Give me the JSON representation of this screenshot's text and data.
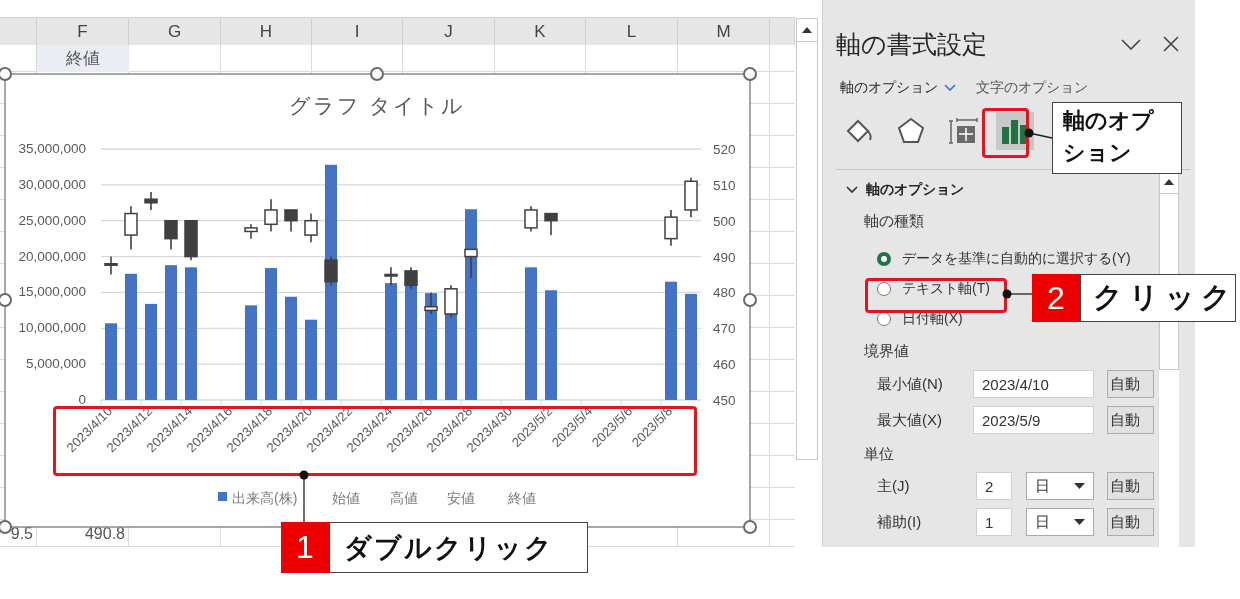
{
  "sheet": {
    "column_headers": [
      "F",
      "G",
      "H",
      "I",
      "J",
      "K",
      "L",
      "M"
    ],
    "rows": [
      {
        "header": true,
        "cells": [
          null,
          "終値"
        ]
      },
      {
        "header": false,
        "cells": [
          "9.5",
          "490.8"
        ]
      }
    ]
  },
  "chart": {
    "selected": true,
    "volume": {
      "chart_data": {
        "type": "bar",
        "title": "グラフ タイトル",
        "categories": [
          "2023/4/10",
          null,
          "2023/4/12",
          null,
          "2023/4/14",
          null,
          "2023/4/16",
          null,
          "2023/4/18",
          null,
          "2023/4/20",
          null,
          "2023/4/22",
          null,
          "2023/4/24",
          null,
          "2023/4/26",
          null,
          "2023/4/28",
          null,
          "2023/4/30",
          null,
          "2023/5/2",
          null,
          "2023/5/4",
          null,
          "2023/5/6",
          null,
          "2023/5/8",
          null
        ],
        "ylim": [
          0,
          35000000
        ],
        "grid": true,
        "yticks": [
          {
            "value": 0,
            "label": "0"
          },
          {
            "value": 5000000,
            "label": "5,000,000"
          },
          {
            "value": 10000000,
            "label": "10,000,000"
          },
          {
            "value": 15000000,
            "label": "15,000,000"
          },
          {
            "value": 20000000,
            "label": "20,000,000"
          },
          {
            "value": 25000000,
            "label": "25,000,000"
          },
          {
            "value": 30000000,
            "label": "30,000,000"
          },
          {
            "value": 35000000,
            "label": "35,000,000"
          }
        ],
        "series": [
          {
            "name": "出来高(株)",
            "color": "#4472c4",
            "values": [
              10700000,
              17600000,
              13400000,
              18800000,
              18500000,
              null,
              null,
              13200000,
              18400000,
              14400000,
              11200000,
              32800000,
              null,
              null,
              16300000,
              16000000,
              14900000,
              15600000,
              26600000,
              null,
              null,
              18500000,
              15300000,
              null,
              null,
              null,
              null,
              null,
              16500000,
              14800000
            ]
          }
        ]
      }
    },
    "prices": {
      "legend": [
        "始値",
        "高値",
        "安値",
        "終値"
      ],
      "chart_data": {
        "type": "candlestick",
        "categories": [
          null,
          null,
          null,
          null,
          null,
          null,
          null,
          null,
          null,
          null,
          null,
          null,
          null,
          null,
          null,
          null,
          null,
          null,
          null,
          null,
          null,
          null,
          null,
          null,
          null,
          null,
          null,
          null,
          null,
          null
        ],
        "ylim": [
          450,
          520
        ],
        "yticks": [
          {
            "value": 450,
            "label": "450"
          },
          {
            "value": 460,
            "label": "460"
          },
          {
            "value": 470,
            "label": "470"
          },
          {
            "value": 480,
            "label": "480"
          },
          {
            "value": 490,
            "label": "490"
          },
          {
            "value": 500,
            "label": "500"
          },
          {
            "value": 510,
            "label": "510"
          },
          {
            "value": 520,
            "label": "520"
          }
        ],
        "ohlc": [
          [
            488,
            490,
            485,
            488
          ],
          [
            496,
            504,
            492,
            502
          ],
          [
            506,
            508,
            503,
            505
          ],
          [
            500,
            500,
            492,
            495
          ],
          [
            500,
            500,
            489,
            490
          ],
          null,
          null,
          [
            497,
            499,
            495,
            498
          ],
          [
            499,
            506,
            497,
            503
          ],
          [
            503,
            503,
            497,
            500
          ],
          [
            496,
            502,
            494,
            500
          ],
          [
            489,
            490,
            482,
            483
          ],
          null,
          null,
          [
            485,
            487,
            482,
            485
          ],
          [
            486,
            487,
            481,
            482
          ],
          [
            475,
            480,
            474,
            476
          ],
          [
            474,
            482,
            473,
            481
          ],
          [
            490,
            492,
            484,
            492
          ],
          null,
          null,
          [
            498,
            504,
            497,
            503
          ],
          [
            502,
            502,
            496,
            500
          ],
          null,
          null,
          null,
          null,
          null,
          [
            495,
            503,
            493,
            501
          ],
          [
            503,
            512,
            501,
            511
          ]
        ]
      }
    }
  },
  "format_pane": {
    "title": "軸の書式設定",
    "option_tabs": [
      {
        "label": "軸のオプション",
        "selected": true
      },
      {
        "label": "文字のオプション",
        "selected": false
      }
    ],
    "icon_tabs": [
      {
        "kind": "fill",
        "selected": false
      },
      {
        "kind": "effects",
        "selected": false
      },
      {
        "kind": "size",
        "selected": false
      },
      {
        "kind": "axis",
        "selected": true
      }
    ],
    "section": {
      "title": "軸のオプション",
      "expanded": true
    },
    "axis_type": {
      "label": "軸の種類",
      "options": [
        {
          "label": "データを基準に自動的に選択する(Y)",
          "selected": true
        },
        {
          "label": "テキスト軸(T)",
          "selected": false
        },
        {
          "label": "日付軸(X)",
          "selected": false
        }
      ]
    },
    "bounds": {
      "label": "境界値",
      "rows": [
        {
          "label": "最小値(N)",
          "value": "2023/4/10",
          "button": "自動"
        },
        {
          "label": "最大値(X)",
          "value": "2023/5/9",
          "button": "自動"
        }
      ]
    },
    "units": {
      "label": "単位",
      "rows": [
        {
          "label": "主(J)",
          "value": "2",
          "unit": "日",
          "button": "自動"
        },
        {
          "label": "補助(I)",
          "value": "1",
          "unit": "日",
          "button": "自動"
        }
      ]
    }
  },
  "callouts": [
    {
      "number": "1",
      "text": "ダブルクリック"
    },
    {
      "number": "2",
      "text": "クリック"
    }
  ],
  "icon_callout": {
    "text": "軸のオプション"
  }
}
